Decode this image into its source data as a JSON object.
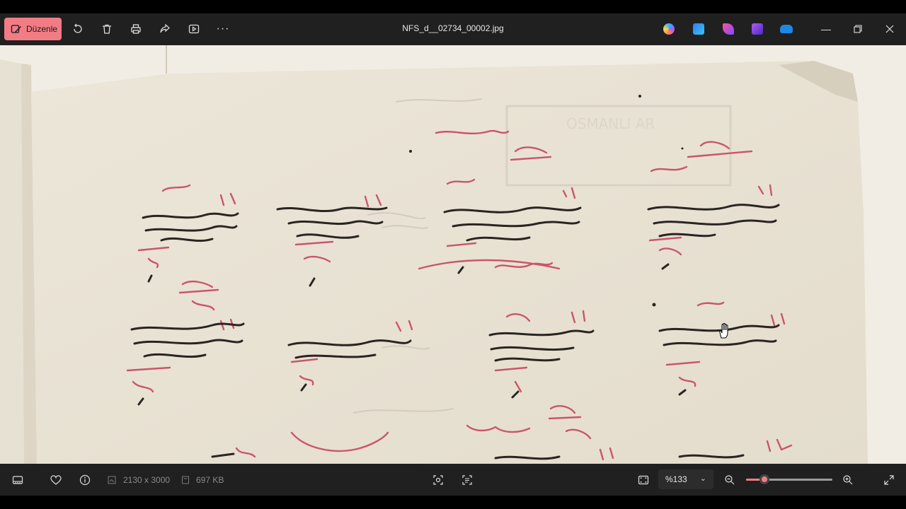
{
  "toolbar": {
    "edit_label": "Düzenle",
    "filename": "NFS_d__02734_00002.jpg",
    "more_glyph": "···"
  },
  "status": {
    "dimensions": "2130 x 3000",
    "filesize": "697 KB",
    "zoom_value": "%133",
    "zoom_level": 0.21
  },
  "colors": {
    "accent": "#f27c84",
    "bar": "#202020",
    "paper": "#e9e3d6",
    "ink_black": "#2a2422",
    "ink_red": "#c9566a"
  }
}
